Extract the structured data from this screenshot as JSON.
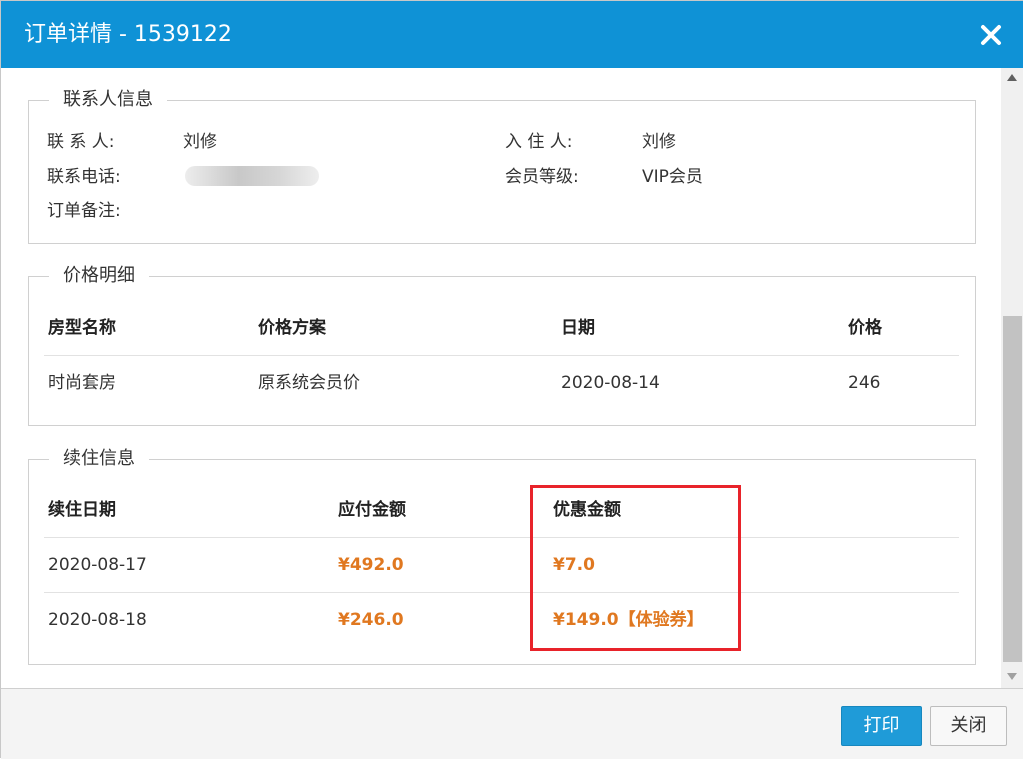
{
  "dialog": {
    "title": "订单详情 - 1539122",
    "close_glyph": "✕"
  },
  "contact": {
    "legend": "联系人信息",
    "contact_label": "联 系 人:",
    "contact_value": "刘修",
    "guest_label": "入 住 人:",
    "guest_value": "刘修",
    "phone_label": "联系电话:",
    "member_label": "会员等级:",
    "member_value": "VIP会员",
    "note_label": "订单备注:"
  },
  "price": {
    "legend": "价格明细",
    "headers": [
      "房型名称",
      "价格方案",
      "日期",
      "价格"
    ],
    "rows": [
      [
        "时尚套房",
        "原系统会员价",
        "2020-08-14",
        "246"
      ]
    ]
  },
  "extension": {
    "legend": "续住信息",
    "headers": [
      "续住日期",
      "应付金额",
      "优惠金额"
    ],
    "rows": [
      [
        "2020-08-17",
        "¥492.0",
        "¥7.0"
      ],
      [
        "2020-08-18",
        "¥246.0",
        "¥149.0【体验券】"
      ]
    ]
  },
  "footer": {
    "print_label": "打印",
    "close_label": "关闭"
  },
  "colors": {
    "titlebar": "#0f92d6",
    "amount": "#e07820",
    "highlight": "#e8232a",
    "primary_button": "#1f9bd8"
  }
}
